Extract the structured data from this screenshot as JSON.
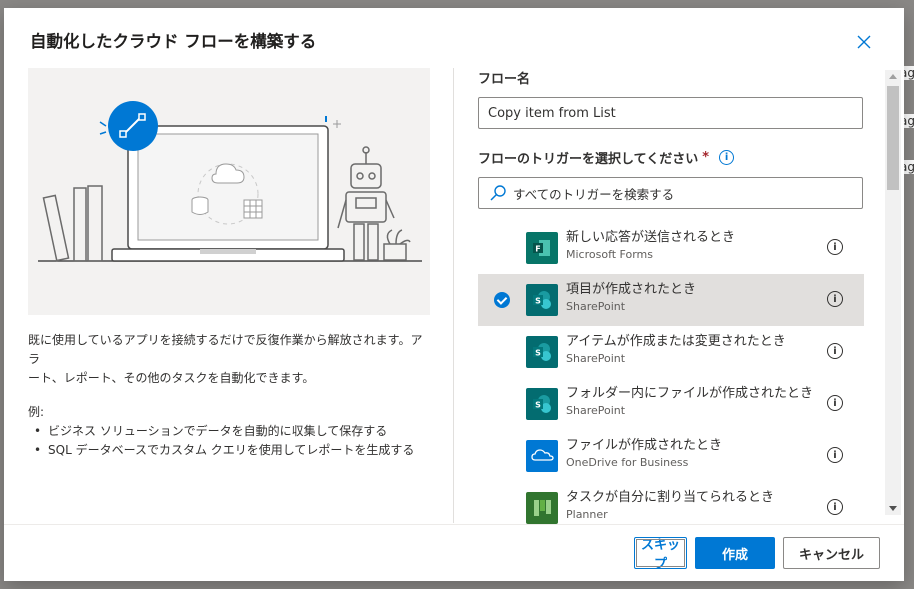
{
  "backdrop": {
    "fragments": [
      "ag",
      "ag",
      "ag"
    ]
  },
  "dialog": {
    "title": "自動化したクラウド フローを構築する",
    "description_line1": "既に使用しているアプリを接続するだけで反復作業から解放されます。アラ",
    "description_line2": "ート、レポート、その他のタスクを自動化できます。",
    "examples_label": "例:",
    "examples": [
      "ビジネス ソリューションでデータを自動的に収集して保存する",
      "SQL データベースでカスタム クエリを使用してレポートを生成する"
    ],
    "flow_name_label": "フロー名",
    "flow_name_value": "Copy item from List",
    "trigger_label": "フローのトリガーを選択してください",
    "required_mark": "*",
    "info_glyph": "i",
    "search_placeholder": "すべてのトリガーを検索する",
    "triggers": [
      {
        "title": "新しい応答が送信されるとき",
        "app": "Microsoft Forms",
        "icon": "forms-icon",
        "color": "#077568",
        "selected": false
      },
      {
        "title": "項目が作成されたとき",
        "app": "SharePoint",
        "icon": "sharepoint-icon",
        "color": "#036C70",
        "selected": true
      },
      {
        "title": "アイテムが作成または変更されたとき",
        "app": "SharePoint",
        "icon": "sharepoint-icon",
        "color": "#036C70",
        "selected": false
      },
      {
        "title": "フォルダー内にファイルが作成されたとき",
        "app": "SharePoint",
        "icon": "sharepoint-icon",
        "color": "#036C70",
        "selected": false
      },
      {
        "title": "ファイルが作成されたとき",
        "app": "OneDrive for Business",
        "icon": "onedrive-icon",
        "color": "#0078D4",
        "selected": false
      },
      {
        "title": "タスクが自分に割り当てられるとき",
        "app": "Planner",
        "icon": "planner-icon",
        "color": "#31752F",
        "selected": false
      }
    ],
    "buttons": {
      "skip": "スキップ",
      "create": "作成",
      "cancel": "キャンセル"
    }
  },
  "colors": {
    "accent": "#0078d4",
    "selected_row": "#e1dfdd",
    "illustration_bg": "#f3f2f1"
  }
}
